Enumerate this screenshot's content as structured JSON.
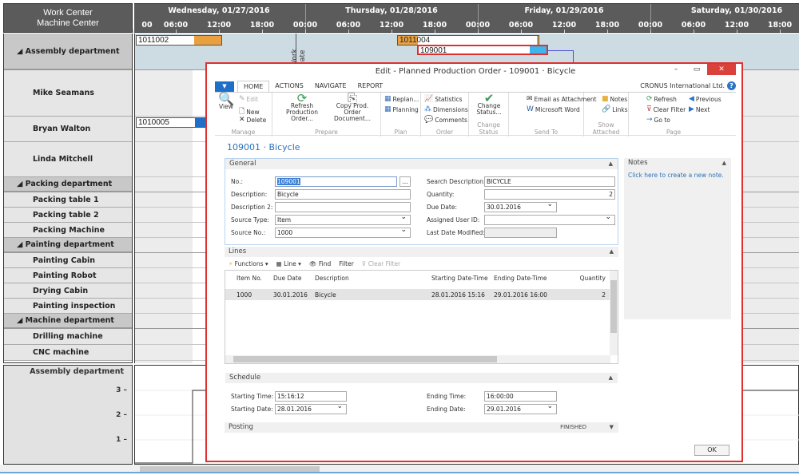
{
  "gantt": {
    "header_left": [
      "Work Center",
      "Machine Center"
    ],
    "days": [
      "Wednesday, 01/27/2016",
      "Thursday, 01/28/2016",
      "Friday, 01/29/2016",
      "Saturday, 01/30/2016"
    ],
    "hours": [
      "00",
      "06:00",
      "12:00",
      "18:00",
      "00:00",
      "06:00",
      "12:00",
      "18:00",
      "00:00",
      "06:00",
      "12:00",
      "18:00",
      "00:00",
      "06:00",
      "12:00",
      "18:00"
    ],
    "work_date_label": "Work Date",
    "rows": [
      {
        "label": "Assembly department",
        "type": "group"
      },
      {
        "label": "Mike Seamans",
        "type": "item"
      },
      {
        "label": "Bryan Walton",
        "type": "item"
      },
      {
        "label": "Linda Mitchell",
        "type": "item"
      },
      {
        "label": "Packing department",
        "type": "group"
      },
      {
        "label": "Packing table 1",
        "type": "item"
      },
      {
        "label": "Packing table 2",
        "type": "item"
      },
      {
        "label": "Packing Machine",
        "type": "item"
      },
      {
        "label": "Painting department",
        "type": "group"
      },
      {
        "label": "Painting Cabin",
        "type": "item"
      },
      {
        "label": "Painting Robot",
        "type": "item"
      },
      {
        "label": "Drying Cabin",
        "type": "item"
      },
      {
        "label": "Painting inspection",
        "type": "item"
      },
      {
        "label": "Machine department",
        "type": "group"
      },
      {
        "label": "Drilling machine",
        "type": "item"
      },
      {
        "label": "CNC machine",
        "type": "item"
      }
    ],
    "bars": [
      {
        "label": "1011002",
        "color": "#e8a040"
      },
      {
        "label": "1011004",
        "color": "#e8a040"
      },
      {
        "label": "109001",
        "color": "#3bb6ef"
      },
      {
        "label": "1010005",
        "color": "#1f6fc9"
      }
    ],
    "load_chart": {
      "title": "Assembly department",
      "yticks": [
        "3",
        "2",
        "1"
      ]
    }
  },
  "dialog": {
    "title": "Edit - Planned Production Order - 109001 · Bicycle",
    "tabs": [
      "HOME",
      "ACTIONS",
      "NAVIGATE",
      "REPORT"
    ],
    "company": "CRONUS International Ltd.",
    "ribbon": {
      "manage": {
        "name": "Manage",
        "view": "View",
        "edit": "Edit",
        "new": "New",
        "delete": "Delete"
      },
      "prepare": {
        "name": "Prepare",
        "refresh": "Refresh Production Order...",
        "copy": "Copy Prod. Order Document..."
      },
      "plan": {
        "name": "Plan",
        "replan": "Replan...",
        "planning": "Planning"
      },
      "order": {
        "name": "Order",
        "statistics": "Statistics",
        "dimensions": "Dimensions",
        "comments": "Comments"
      },
      "change_status": {
        "name": "Change Status",
        "change": "Change Status..."
      },
      "send_to": {
        "name": "Send To",
        "email": "Email as Attachment",
        "word": "Microsoft Word"
      },
      "show_attached": {
        "name": "Show Attached",
        "notes": "Notes",
        "links": "Links"
      },
      "page": {
        "name": "Page",
        "refresh": "Refresh",
        "clear_filter": "Clear Filter",
        "goto": "Go to",
        "previous": "Previous",
        "next": "Next"
      }
    },
    "doc_title": "109001 · Bicycle",
    "general": {
      "header": "General",
      "no_label": "No.:",
      "no": "109001",
      "desc_label": "Description:",
      "desc": "Bicycle",
      "desc2_label": "Description 2:",
      "desc2": "",
      "source_type_label": "Source Type:",
      "source_type": "Item",
      "source_no_label": "Source No.:",
      "source_no": "1000",
      "search_desc_label": "Search Description:",
      "search_desc": "BICYCLE",
      "qty_label": "Quantity:",
      "qty": "2",
      "due_label": "Due Date:",
      "due": "30.01.2016",
      "user_label": "Assigned User ID:",
      "user": "",
      "modified_label": "Last Date Modified:",
      "modified": ""
    },
    "notes": {
      "header": "Notes",
      "link": "Click here to create a new note."
    },
    "lines": {
      "header": "Lines",
      "toolbar": [
        "Functions",
        "Line",
        "Find",
        "Filter",
        "Clear Filter"
      ],
      "columns": [
        "Item No.",
        "Due Date",
        "Description",
        "Starting Date-Time",
        "Ending Date-Time",
        "Quantity"
      ],
      "rows": [
        [
          "1000",
          "30.01.2016",
          "Bicycle",
          "28.01.2016 15:16",
          "29.01.2016 16:00",
          "2"
        ]
      ]
    },
    "schedule": {
      "header": "Schedule",
      "start_time_label": "Starting Time:",
      "start_time": "15:16:12",
      "start_date_label": "Starting Date:",
      "start_date": "28.01.2016",
      "end_time_label": "Ending Time:",
      "end_time": "16:00:00",
      "end_date_label": "Ending Date:",
      "end_date": "29.01.2016"
    },
    "posting": {
      "header": "Posting",
      "status": "FINISHED"
    },
    "ok": "OK"
  }
}
